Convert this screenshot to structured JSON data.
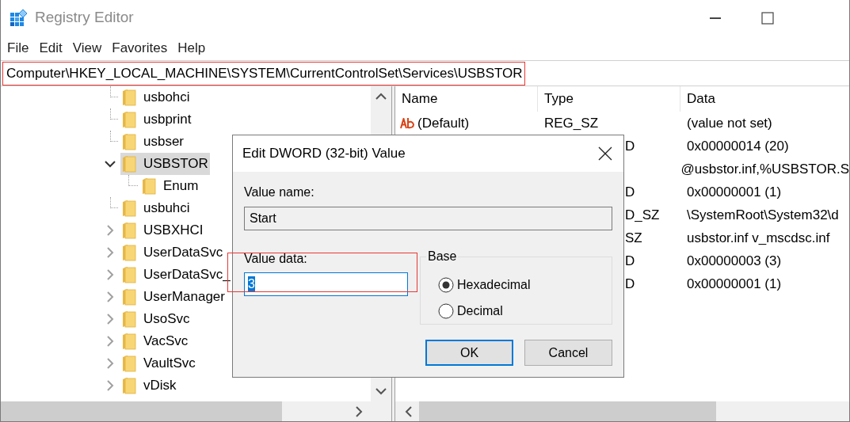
{
  "window": {
    "title": "Registry Editor"
  },
  "menu": [
    "File",
    "Edit",
    "View",
    "Favorites",
    "Help"
  ],
  "address": "Computer\\HKEY_LOCAL_MACHINE\\SYSTEM\\CurrentControlSet\\Services\\USBSTOR",
  "tree": [
    {
      "label": "usbohci",
      "kind": "leaf",
      "selected": false
    },
    {
      "label": "usbprint",
      "kind": "leaf",
      "selected": false
    },
    {
      "label": "usbser",
      "kind": "leaf",
      "selected": false
    },
    {
      "label": "USBSTOR",
      "kind": "branch",
      "expanded": true,
      "selected": true,
      "children": [
        {
          "label": "Enum",
          "kind": "leaf",
          "selected": false
        }
      ]
    },
    {
      "label": "usbuhci",
      "kind": "leaf",
      "selected": false
    },
    {
      "label": "USBXHCI",
      "kind": "branch",
      "expanded": false,
      "selected": false
    },
    {
      "label": "UserDataSvc",
      "kind": "branch",
      "expanded": false,
      "selected": false
    },
    {
      "label": "UserDataSvc_",
      "kind": "branch",
      "expanded": false,
      "selected": false
    },
    {
      "label": "UserManager",
      "kind": "branch",
      "expanded": false,
      "selected": false
    },
    {
      "label": "UsoSvc",
      "kind": "branch",
      "expanded": false,
      "selected": false
    },
    {
      "label": "VacSvc",
      "kind": "branch",
      "expanded": false,
      "selected": false
    },
    {
      "label": "VaultSvc",
      "kind": "branch",
      "expanded": false,
      "selected": false
    },
    {
      "label": "vDisk",
      "kind": "branch",
      "expanded": false,
      "selected": false
    }
  ],
  "values": {
    "columns": [
      "Name",
      "Type",
      "Data"
    ],
    "rows": [
      {
        "name": "(Default)",
        "type": "REG_SZ",
        "data": "(value not set)"
      },
      {
        "type": "D",
        "data": "0x00000014 (20)"
      },
      {
        "data": "@usbstor.inf,%USBSTOR.S"
      },
      {
        "type": "D",
        "data": "0x00000001 (1)"
      },
      {
        "type": "D_SZ",
        "data": "\\SystemRoot\\System32\\d"
      },
      {
        "type": "SZ",
        "data": "usbstor.inf v_mscdsc.inf"
      },
      {
        "type": "D",
        "data": "0x00000003 (3)"
      },
      {
        "type": "D",
        "data": "0x00000001 (1)"
      }
    ]
  },
  "dialog": {
    "title": "Edit DWORD (32-bit) Value",
    "value_name_label": "Value name:",
    "value_name": "Start",
    "value_data_label": "Value data:",
    "value_data": "3",
    "base": {
      "label": "Base",
      "options": [
        {
          "label": "Hexadecimal",
          "selected": true
        },
        {
          "label": "Decimal",
          "selected": false
        }
      ]
    },
    "buttons": [
      {
        "label": "OK",
        "default": true
      },
      {
        "label": "Cancel",
        "default": false
      }
    ]
  }
}
